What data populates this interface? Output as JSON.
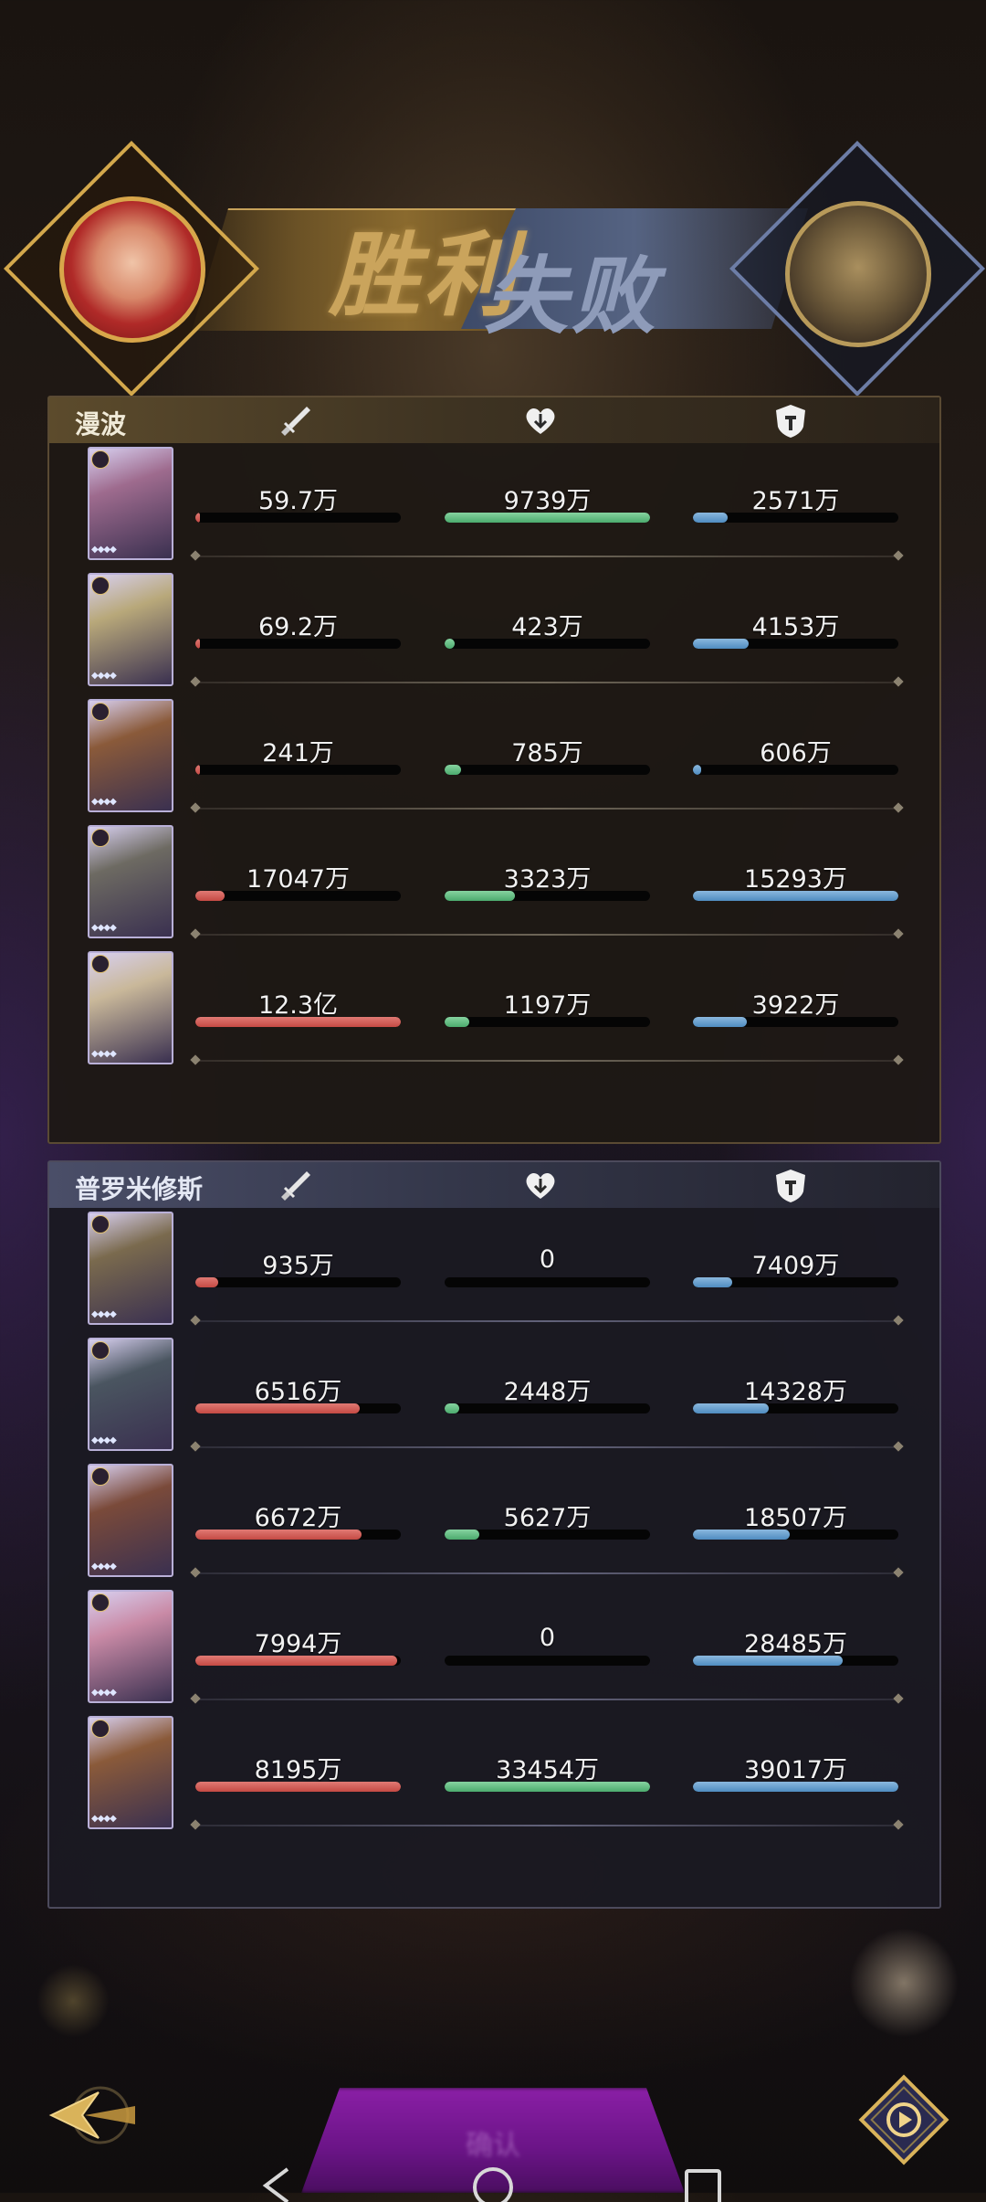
{
  "result": {
    "win_label": "胜利",
    "lose_label": "失败"
  },
  "teams": [
    {
      "name": "漫波",
      "rows": [
        {
          "card_color": "#9e6b8e",
          "atk": {
            "label": "59.7万",
            "pct": 2
          },
          "heal": {
            "label": "9739万",
            "pct": 100
          },
          "def": {
            "label": "2571万",
            "pct": 17
          }
        },
        {
          "card_color": "#b8a87a",
          "atk": {
            "label": "69.2万",
            "pct": 2
          },
          "heal": {
            "label": "423万",
            "pct": 5
          },
          "def": {
            "label": "4153万",
            "pct": 27
          }
        },
        {
          "card_color": "#8a5a3a",
          "atk": {
            "label": "241万",
            "pct": 2
          },
          "heal": {
            "label": "785万",
            "pct": 8
          },
          "def": {
            "label": "606万",
            "pct": 4
          }
        },
        {
          "card_color": "#6d6a62",
          "atk": {
            "label": "17047万",
            "pct": 14
          },
          "heal": {
            "label": "3323万",
            "pct": 34
          },
          "def": {
            "label": "15293万",
            "pct": 100
          }
        },
        {
          "card_color": "#c9b89a",
          "atk": {
            "label": "12.3亿",
            "pct": 100
          },
          "heal": {
            "label": "1197万",
            "pct": 12
          },
          "def": {
            "label": "3922万",
            "pct": 26
          }
        }
      ]
    },
    {
      "name": "普罗米修斯",
      "rows": [
        {
          "card_color": "#7a6a4e",
          "atk": {
            "label": "935万",
            "pct": 11
          },
          "heal": {
            "label": "0",
            "pct": 0
          },
          "def": {
            "label": "7409万",
            "pct": 19
          }
        },
        {
          "card_color": "#4a5560",
          "atk": {
            "label": "6516万",
            "pct": 80
          },
          "heal": {
            "label": "2448万",
            "pct": 7
          },
          "def": {
            "label": "14328万",
            "pct": 37
          }
        },
        {
          "card_color": "#7a4a3a",
          "atk": {
            "label": "6672万",
            "pct": 81
          },
          "heal": {
            "label": "5627万",
            "pct": 17
          },
          "def": {
            "label": "18507万",
            "pct": 47
          }
        },
        {
          "card_color": "#c98aa6",
          "atk": {
            "label": "7994万",
            "pct": 98
          },
          "heal": {
            "label": "0",
            "pct": 0
          },
          "def": {
            "label": "28485万",
            "pct": 73
          }
        },
        {
          "card_color": "#8a5a3a",
          "atk": {
            "label": "8195万",
            "pct": 100
          },
          "heal": {
            "label": "33454万",
            "pct": 100
          },
          "def": {
            "label": "39017万",
            "pct": 100
          }
        }
      ]
    }
  ],
  "icons": {
    "attack": "sword-icon",
    "heal": "heart-icon",
    "defense": "shield-icon",
    "back": "back-arrow-icon",
    "replay": "replay-icon"
  }
}
